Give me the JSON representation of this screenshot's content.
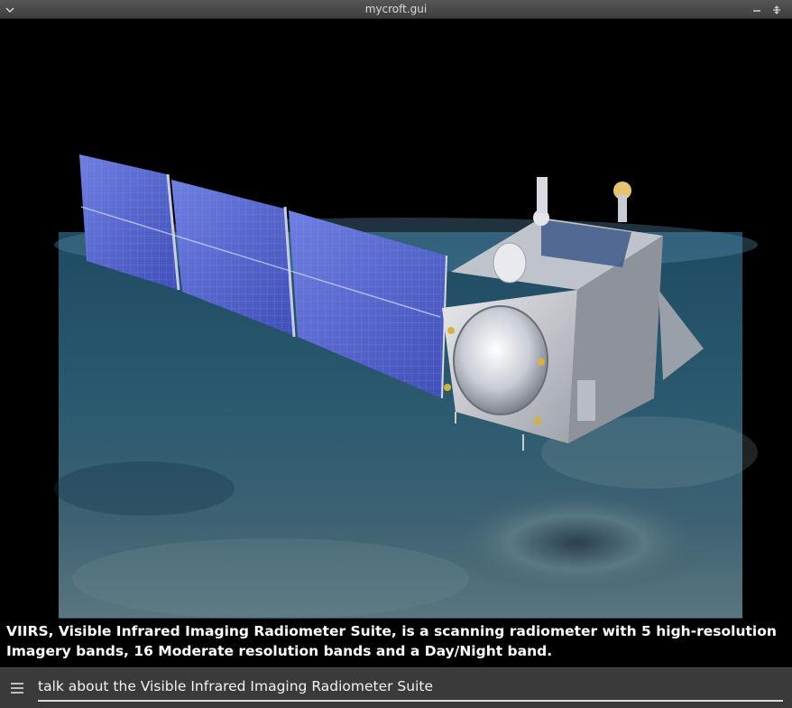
{
  "window": {
    "title": "mycroft.gui"
  },
  "display": {
    "image_subject": "satellite-image",
    "caption": "VIIRS, Visible Infrared Imaging Radiometer Suite, is a scanning radiometer with 5 high-resolution Imagery bands, 16 Moderate resolution bands and a Day/Night band."
  },
  "input": {
    "value": "talk about the Visible Infrared Imaging Radiometer Suite"
  },
  "icons": {
    "menu": "chevron-down-icon",
    "minimize": "minimize-icon",
    "maximize": "maximize-icon",
    "hamburger": "hamburger-menu-icon"
  }
}
